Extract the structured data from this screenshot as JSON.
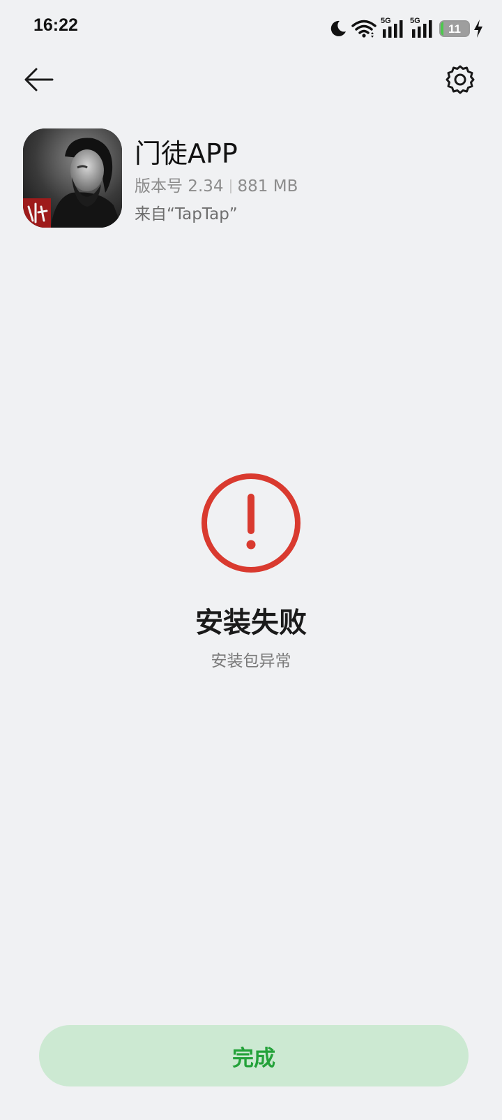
{
  "status_bar": {
    "time": "16:22",
    "network_1": "5G",
    "network_2": "5G",
    "battery_level": "11",
    "battery_percent": 11,
    "icons": [
      "moon-icon",
      "wifi-icon",
      "signal-5g-icon",
      "signal-5g-icon",
      "battery-icon",
      "charging-icon"
    ]
  },
  "header": {
    "back_icon": "arrow-left-icon",
    "settings_icon": "gear-icon"
  },
  "app": {
    "name": "门徒APP",
    "version": "版本号 2.34",
    "size": "881 MB",
    "source": "来自“TapTap”"
  },
  "result": {
    "icon": "exclamation-circle-icon",
    "title": "安装失败",
    "subtitle": "安装包异常"
  },
  "actions": {
    "done_label": "完成"
  },
  "colors": {
    "background": "#F0F1F3",
    "error_red": "#D93A2F",
    "button_bg": "#CCE9D2",
    "button_text": "#24A23A",
    "battery_green": "#4CC94C"
  }
}
